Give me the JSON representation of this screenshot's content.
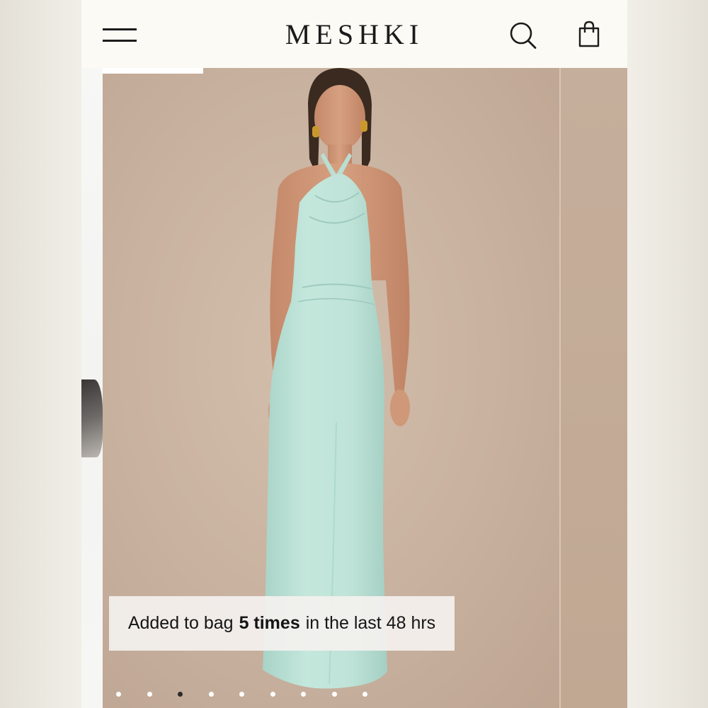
{
  "header": {
    "brand": "MESHKI",
    "menu_icon": "hamburger-menu-icon",
    "search_icon": "search-icon",
    "bag_icon": "shopping-bag-icon"
  },
  "product_gallery": {
    "dress_color": "#bfe3d8",
    "background_color": "#c8b19f",
    "toast": {
      "prefix": "Added to bag",
      "count": "5 times",
      "suffix": "in the last 48 hrs"
    },
    "pagination": {
      "total": 9,
      "active_index": 2
    }
  }
}
